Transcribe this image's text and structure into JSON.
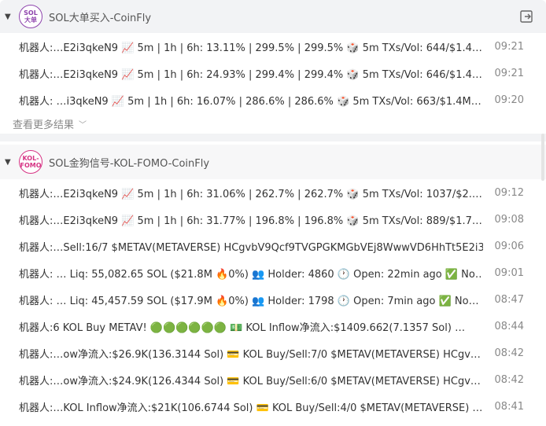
{
  "groups": [
    {
      "title": "SOL大单买入-CoinFly",
      "avatar_line1": "SOL",
      "avatar_line2": "大单",
      "rows": [
        {
          "text": "机器人:…E2i3qkeN9 📈 5m | 1h | 6h: 13.11% | 299.5% | 299.5% 🎲 5m TXs/Vol: 644/$1.4…",
          "time": "09:21"
        },
        {
          "text": "机器人:…E2i3qkeN9 📈 5m | 1h | 6h: 24.93% | 299.4% | 299.4% 🎲 5m TXs/Vol: 646/$1.4…",
          "time": "09:21"
        },
        {
          "text": "机器人: …i3qkeN9 📈 5m | 1h | 6h: 16.07% | 286.6% | 286.6% 🎲 5m TXs/Vol: 663/$1.4M…",
          "time": "09:20"
        }
      ],
      "more_label": "查看更多结果"
    },
    {
      "title": "SOL金狗信号-KOL-FOMO-CoinFly",
      "avatar_line1": "KOL-",
      "avatar_line2": "FOMO",
      "rows": [
        {
          "text": "机器人:…E2i3qkeN9 📈 5m | 1h | 6h: 31.06% | 262.7% | 262.7% 🎲 5m TXs/Vol: 1037/$2.…",
          "time": "09:12"
        },
        {
          "text": "机器人:…E2i3qkeN9 📈 5m | 1h | 6h: 31.77% | 196.8% | 196.8% 🎲 5m TXs/Vol: 889/$1.7…",
          "time": "09:08"
        },
        {
          "text": "机器人:…Sell:16/7 $METAV(METAVERSE) HCgvbV9Qcf9TVGPGKMGbVEj8WwwVD6HhTt5E2i3…",
          "time": "09:06"
        },
        {
          "text": "机器人: … Liq: 55,082.65 SOL ($21.8M 🔥0%) 👥 Holder: 4860 🕐 Open: 22min ago ✅ No…",
          "time": "09:01"
        },
        {
          "text": "机器人:   … Liq: 45,457.59 SOL ($17.9M 🔥0%) 👥 Holder: 1798 🕐 Open: 7min ago ✅ No…",
          "time": "08:47"
        },
        {
          "text": "机器人:6 KOL Buy METAV! 🟢🟢🟢🟢🟢🟢 💵 KOL Inflow净流入:$1409.662(7.1357 Sol) …",
          "time": "08:44"
        },
        {
          "text": "机器人:…ow净流入:$26.9K(136.3144 Sol) 💳 KOL Buy/Sell:7/0 $METAV(METAVERSE) HCgv…",
          "time": "08:42"
        },
        {
          "text": "机器人:…ow净流入:$24.9K(126.4344 Sol) 💳 KOL Buy/Sell:6/0 $METAV(METAVERSE) HCgv…",
          "time": "08:42"
        },
        {
          "text": "机器人:…KOL Inflow净流入:$21K(106.6744 Sol) 💳 KOL Buy/Sell:4/0 $METAV(METAVERSE) …",
          "time": "08:41"
        }
      ]
    }
  ]
}
